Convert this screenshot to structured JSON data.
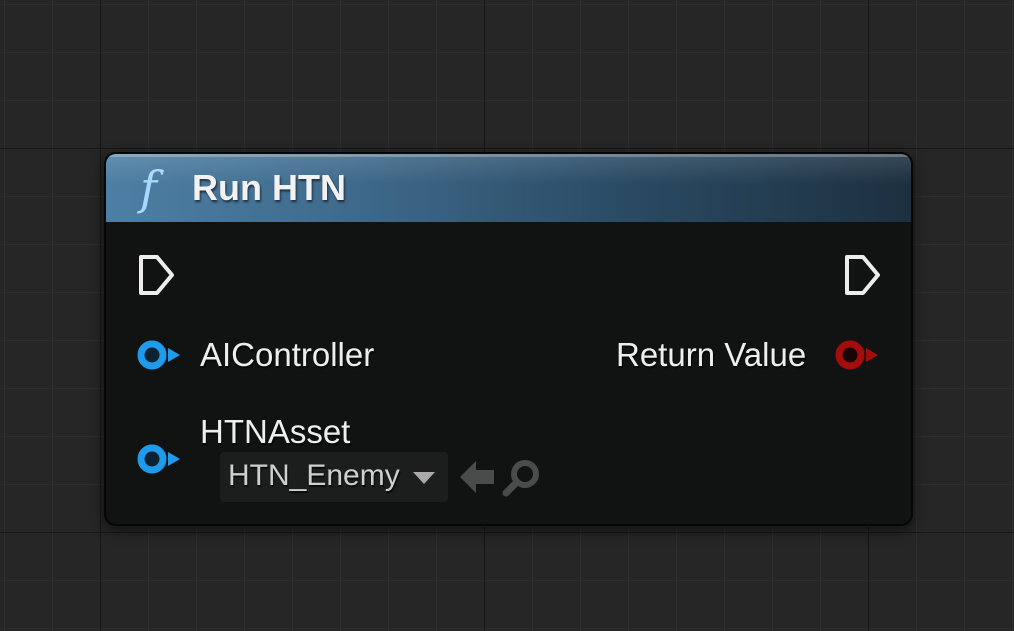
{
  "node": {
    "title": "Run HTN",
    "icon": "function-icon",
    "icon_glyph": "f",
    "header_color": "#4d7fa4"
  },
  "pins": {
    "exec_in": {
      "icon": "exec-pin-icon"
    },
    "exec_out": {
      "icon": "exec-pin-icon"
    },
    "ai_controller": {
      "label": "AIController",
      "color": "#1e9bea"
    },
    "htn_asset": {
      "label": "HTNAsset",
      "color": "#1e9bea",
      "value": "HTN_Enemy"
    },
    "return_value": {
      "label": "Return Value",
      "color": "#a50d0d"
    }
  },
  "asset_actions": {
    "use_selected": "back-arrow-icon",
    "browse": "search-icon"
  }
}
